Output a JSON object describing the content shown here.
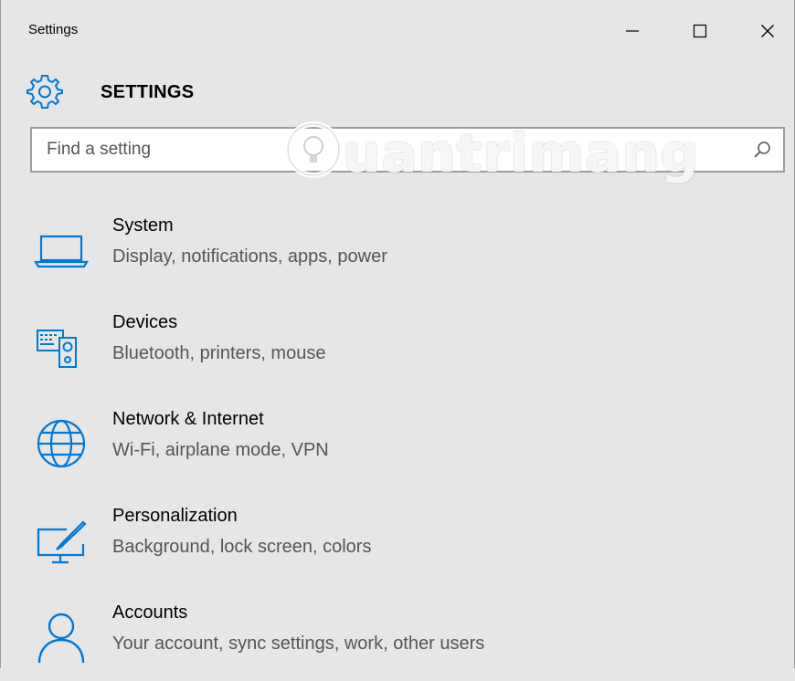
{
  "window": {
    "title": "Settings",
    "controls": {
      "minimize": "minimize",
      "maximize": "maximize",
      "close": "close"
    }
  },
  "header": {
    "title": "SETTINGS",
    "icon": "gear-icon"
  },
  "search": {
    "placeholder": "Find a setting",
    "value": ""
  },
  "watermark": {
    "text": "uantrimang"
  },
  "accent_color": "#0078d7",
  "categories": [
    {
      "name": "System",
      "description": "Display, notifications, apps, power",
      "icon": "laptop-icon"
    },
    {
      "name": "Devices",
      "description": "Bluetooth, printers, mouse",
      "icon": "keyboard-speaker-icon"
    },
    {
      "name": "Network & Internet",
      "description": "Wi-Fi, airplane mode, VPN",
      "icon": "globe-icon"
    },
    {
      "name": "Personalization",
      "description": "Background, lock screen, colors",
      "icon": "paintbrush-monitor-icon"
    },
    {
      "name": "Accounts",
      "description": "Your account, sync settings, work, other users",
      "icon": "person-icon"
    }
  ]
}
